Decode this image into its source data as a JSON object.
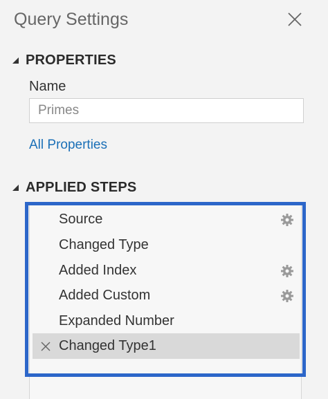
{
  "pane": {
    "title": "Query Settings"
  },
  "properties": {
    "header": "PROPERTIES",
    "name_label": "Name",
    "name_value": "Primes",
    "all_properties_link": "All Properties"
  },
  "applied_steps": {
    "header": "APPLIED STEPS",
    "steps": [
      {
        "label": "Source",
        "has_settings": true,
        "selected": false
      },
      {
        "label": "Changed Type",
        "has_settings": false,
        "selected": false
      },
      {
        "label": "Added Index",
        "has_settings": true,
        "selected": false
      },
      {
        "label": "Added Custom",
        "has_settings": true,
        "selected": false
      },
      {
        "label": "Expanded Number",
        "has_settings": false,
        "selected": false
      },
      {
        "label": "Changed Type1",
        "has_settings": false,
        "selected": true
      }
    ]
  },
  "colors": {
    "accent": "#2c66c9",
    "link": "#1a6fb7",
    "selected_row": "#d9d9d9",
    "pane_background": "#f3f3f3"
  },
  "icons": {
    "close": "close-icon",
    "collapse": "caret-down-icon",
    "step_settings": "gear-icon",
    "delete_step": "delete-icon"
  }
}
